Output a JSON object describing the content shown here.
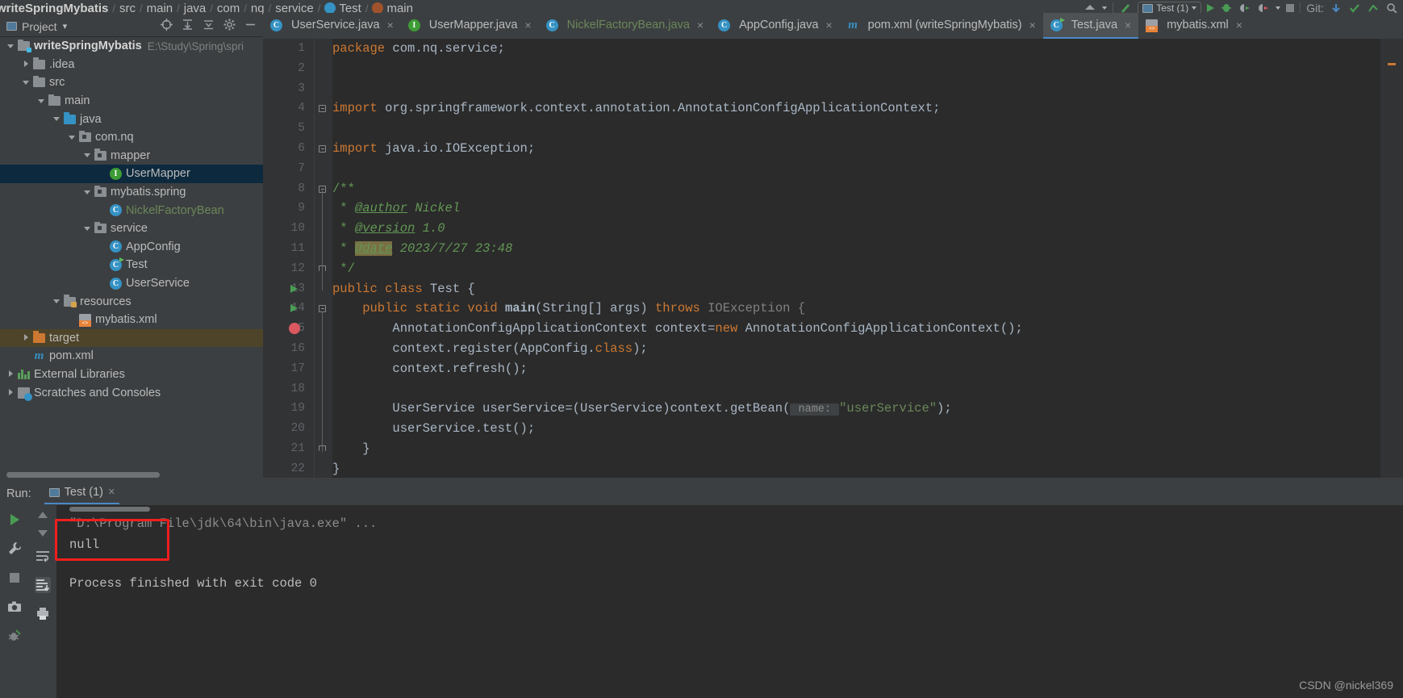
{
  "app": {
    "theme_bg": "#3c3f41",
    "editor_bg": "#2b2b2b",
    "accent": "#4a88c7",
    "annotation_color": "#f01f1f"
  },
  "navbar": {
    "crumbs": [
      {
        "label": "writeSpringMybatis",
        "bold": true
      },
      {
        "label": "src"
      },
      {
        "label": "main"
      },
      {
        "label": "java"
      },
      {
        "label": "com"
      },
      {
        "label": "nq"
      },
      {
        "label": "service"
      },
      {
        "label": "Test",
        "icon": "class-icon"
      },
      {
        "label": "main",
        "icon": "method-icon"
      }
    ],
    "separator": "/",
    "run_config": "Test (1)",
    "git_label": "Git:"
  },
  "project_panel": {
    "title": "Project",
    "title_chevron": "▾",
    "icons": [
      "locate-icon",
      "expand-all-icon",
      "collapse-all-icon",
      "settings-gear-icon",
      "hide-icon"
    ],
    "tree": [
      {
        "depth": 0,
        "arrow": "down",
        "icon": "module-folder-icon",
        "label": "writeSpringMybatis",
        "bold": true,
        "path": "E:\\Study\\Spring\\spri"
      },
      {
        "depth": 1,
        "arrow": "right",
        "icon": "folder-icon",
        "label": ".idea"
      },
      {
        "depth": 1,
        "arrow": "down",
        "icon": "folder-icon",
        "label": "src"
      },
      {
        "depth": 2,
        "arrow": "down",
        "icon": "folder-icon",
        "label": "main"
      },
      {
        "depth": 3,
        "arrow": "down",
        "icon": "source-folder-icon",
        "label": "java"
      },
      {
        "depth": 4,
        "arrow": "down",
        "icon": "package-icon",
        "label": "com.nq"
      },
      {
        "depth": 5,
        "arrow": "down",
        "icon": "package-icon",
        "label": "mapper"
      },
      {
        "depth": 6,
        "arrow": "none",
        "icon": "interface-icon",
        "label": "UserMapper",
        "selected": true
      },
      {
        "depth": 5,
        "arrow": "down",
        "icon": "package-icon",
        "label": "mybatis.spring"
      },
      {
        "depth": 6,
        "arrow": "none",
        "icon": "class-icon",
        "label": "NickelFactoryBean",
        "green": true
      },
      {
        "depth": 5,
        "arrow": "down",
        "icon": "package-icon",
        "label": "service"
      },
      {
        "depth": 6,
        "arrow": "none",
        "icon": "class-icon",
        "label": "AppConfig"
      },
      {
        "depth": 6,
        "arrow": "none",
        "icon": "runnable-class-icon",
        "label": "Test"
      },
      {
        "depth": 6,
        "arrow": "none",
        "icon": "class-icon",
        "label": "UserService"
      },
      {
        "depth": 3,
        "arrow": "down",
        "icon": "resources-folder-icon",
        "label": "resources"
      },
      {
        "depth": 4,
        "arrow": "none",
        "icon": "xml-file-icon",
        "label": "mybatis.xml"
      },
      {
        "depth": 1,
        "arrow": "right",
        "icon": "target-folder-icon",
        "label": "target",
        "highlighted": true
      },
      {
        "depth": 1,
        "arrow": "none",
        "icon": "maven-icon",
        "label": "pom.xml"
      },
      {
        "depth": 0,
        "arrow": "right",
        "icon": "libraries-icon",
        "label": "External Libraries"
      },
      {
        "depth": 0,
        "arrow": "right",
        "icon": "scratches-icon",
        "label": "Scratches and Consoles"
      }
    ]
  },
  "editor_tabs": [
    {
      "label": "UserService.java",
      "icon": "class-icon",
      "active": false,
      "closable": true
    },
    {
      "label": "UserMapper.java",
      "icon": "interface-icon",
      "active": false,
      "closable": true
    },
    {
      "label": "NickelFactoryBean.java",
      "icon": "class-icon",
      "active": false,
      "closable": true,
      "green": true
    },
    {
      "label": "AppConfig.java",
      "icon": "class-icon",
      "active": false,
      "closable": true
    },
    {
      "label": "pom.xml (writeSpringMybatis)",
      "icon": "maven-icon",
      "active": false,
      "closable": true
    },
    {
      "label": "Test.java",
      "icon": "runnable-class-icon",
      "active": true,
      "closable": true
    },
    {
      "label": "mybatis.xml",
      "icon": "xml-file-icon",
      "active": false,
      "closable": true
    }
  ],
  "editor": {
    "file": "Test.java",
    "line_count": 22,
    "breakpoint_line": 15,
    "run_marker_lines": [
      13,
      14
    ],
    "lines": [
      {
        "n": 1,
        "segments": [
          {
            "t": "package ",
            "c": "kw"
          },
          {
            "t": "com.nq.service;",
            "c": "typ"
          }
        ]
      },
      {
        "n": 2,
        "segments": []
      },
      {
        "n": 3,
        "segments": []
      },
      {
        "n": 4,
        "segments": [
          {
            "t": "import ",
            "c": "kw"
          },
          {
            "t": "org.springframework.context.annotation.AnnotationConfigApplicationContext;",
            "c": "typ"
          }
        ]
      },
      {
        "n": 5,
        "segments": []
      },
      {
        "n": 6,
        "segments": [
          {
            "t": "import ",
            "c": "kw"
          },
          {
            "t": "java.io.IOException;",
            "c": "typ"
          }
        ]
      },
      {
        "n": 7,
        "segments": []
      },
      {
        "n": 8,
        "segments": [
          {
            "t": "/**",
            "c": "cmt"
          }
        ]
      },
      {
        "n": 9,
        "segments": [
          {
            "t": " * ",
            "c": "cmt"
          },
          {
            "t": "@author",
            "c": "cmt-tag"
          },
          {
            "t": " Nickel",
            "c": "cmt-i"
          }
        ]
      },
      {
        "n": 10,
        "segments": [
          {
            "t": " * ",
            "c": "cmt"
          },
          {
            "t": "@version",
            "c": "cmt-tag"
          },
          {
            "t": " 1.0",
            "c": "cmt-i"
          }
        ]
      },
      {
        "n": 11,
        "segments": [
          {
            "t": " * ",
            "c": "cmt"
          },
          {
            "t": "@date",
            "c": "cmt-hl"
          },
          {
            "t": " 2023/7/27 23:48",
            "c": "cmt-i"
          }
        ]
      },
      {
        "n": 12,
        "segments": [
          {
            "t": " */",
            "c": "cmt"
          }
        ]
      },
      {
        "n": 13,
        "segments": [
          {
            "t": "public class ",
            "c": "kw"
          },
          {
            "t": "Test {",
            "c": "typ"
          }
        ]
      },
      {
        "n": 14,
        "segments": [
          {
            "t": "    public static void ",
            "c": "kw"
          },
          {
            "t": "main",
            "c": "bold-m"
          },
          {
            "t": "(String[] args) ",
            "c": "typ"
          },
          {
            "t": "throws ",
            "c": "kw"
          },
          {
            "t": "IOException {",
            "c": "grey"
          }
        ]
      },
      {
        "n": 15,
        "segments": [
          {
            "t": "        AnnotationConfigApplicationContext context=",
            "c": "typ"
          },
          {
            "t": "new ",
            "c": "kw"
          },
          {
            "t": "AnnotationConfigApplicationContext();",
            "c": "typ"
          }
        ]
      },
      {
        "n": 16,
        "segments": [
          {
            "t": "        context.register(AppConfig.",
            "c": "typ"
          },
          {
            "t": "class",
            "c": "kw"
          },
          {
            "t": ");",
            "c": "typ"
          }
        ]
      },
      {
        "n": 17,
        "segments": [
          {
            "t": "        context.refresh();",
            "c": "typ"
          }
        ]
      },
      {
        "n": 18,
        "segments": []
      },
      {
        "n": 19,
        "segments": [
          {
            "t": "        UserService userService=(UserService)context.getBean(",
            "c": "typ"
          },
          {
            "t": " name: ",
            "c": "hint"
          },
          {
            "t": "\"userService\"",
            "c": "str"
          },
          {
            "t": ");",
            "c": "typ"
          }
        ]
      },
      {
        "n": 20,
        "segments": [
          {
            "t": "        userService.test();",
            "c": "typ"
          }
        ]
      },
      {
        "n": 21,
        "segments": [
          {
            "t": "    }",
            "c": "typ"
          }
        ]
      },
      {
        "n": 22,
        "segments": [
          {
            "t": "}",
            "c": "typ"
          }
        ]
      }
    ]
  },
  "run_panel": {
    "label": "Run:",
    "tab": "Test (1)",
    "tab_icon": "console-icon",
    "close_icon": "×",
    "side_icons_left": [
      "rerun-icon",
      "wrench-icon",
      "stop-icon",
      "camera-icon",
      "thread-dump-icon"
    ],
    "side_icons_right": [
      "up-arrow-icon",
      "down-arrow-icon",
      "soft-wrap-icon",
      "scroll-to-end-icon",
      "print-icon"
    ],
    "console_lines": [
      {
        "text": "\"D:\\Program File\\jdk\\64\\bin\\java.exe\" ...",
        "dim": true
      },
      {
        "text": "null",
        "dim": false
      },
      {
        "text": "Process finished with exit code 0",
        "dim": false
      }
    ]
  },
  "annotation": {
    "shape": "rectangle",
    "color": "#f01f1f",
    "targets_text": "null"
  },
  "watermark": "CSDN @nickel369"
}
